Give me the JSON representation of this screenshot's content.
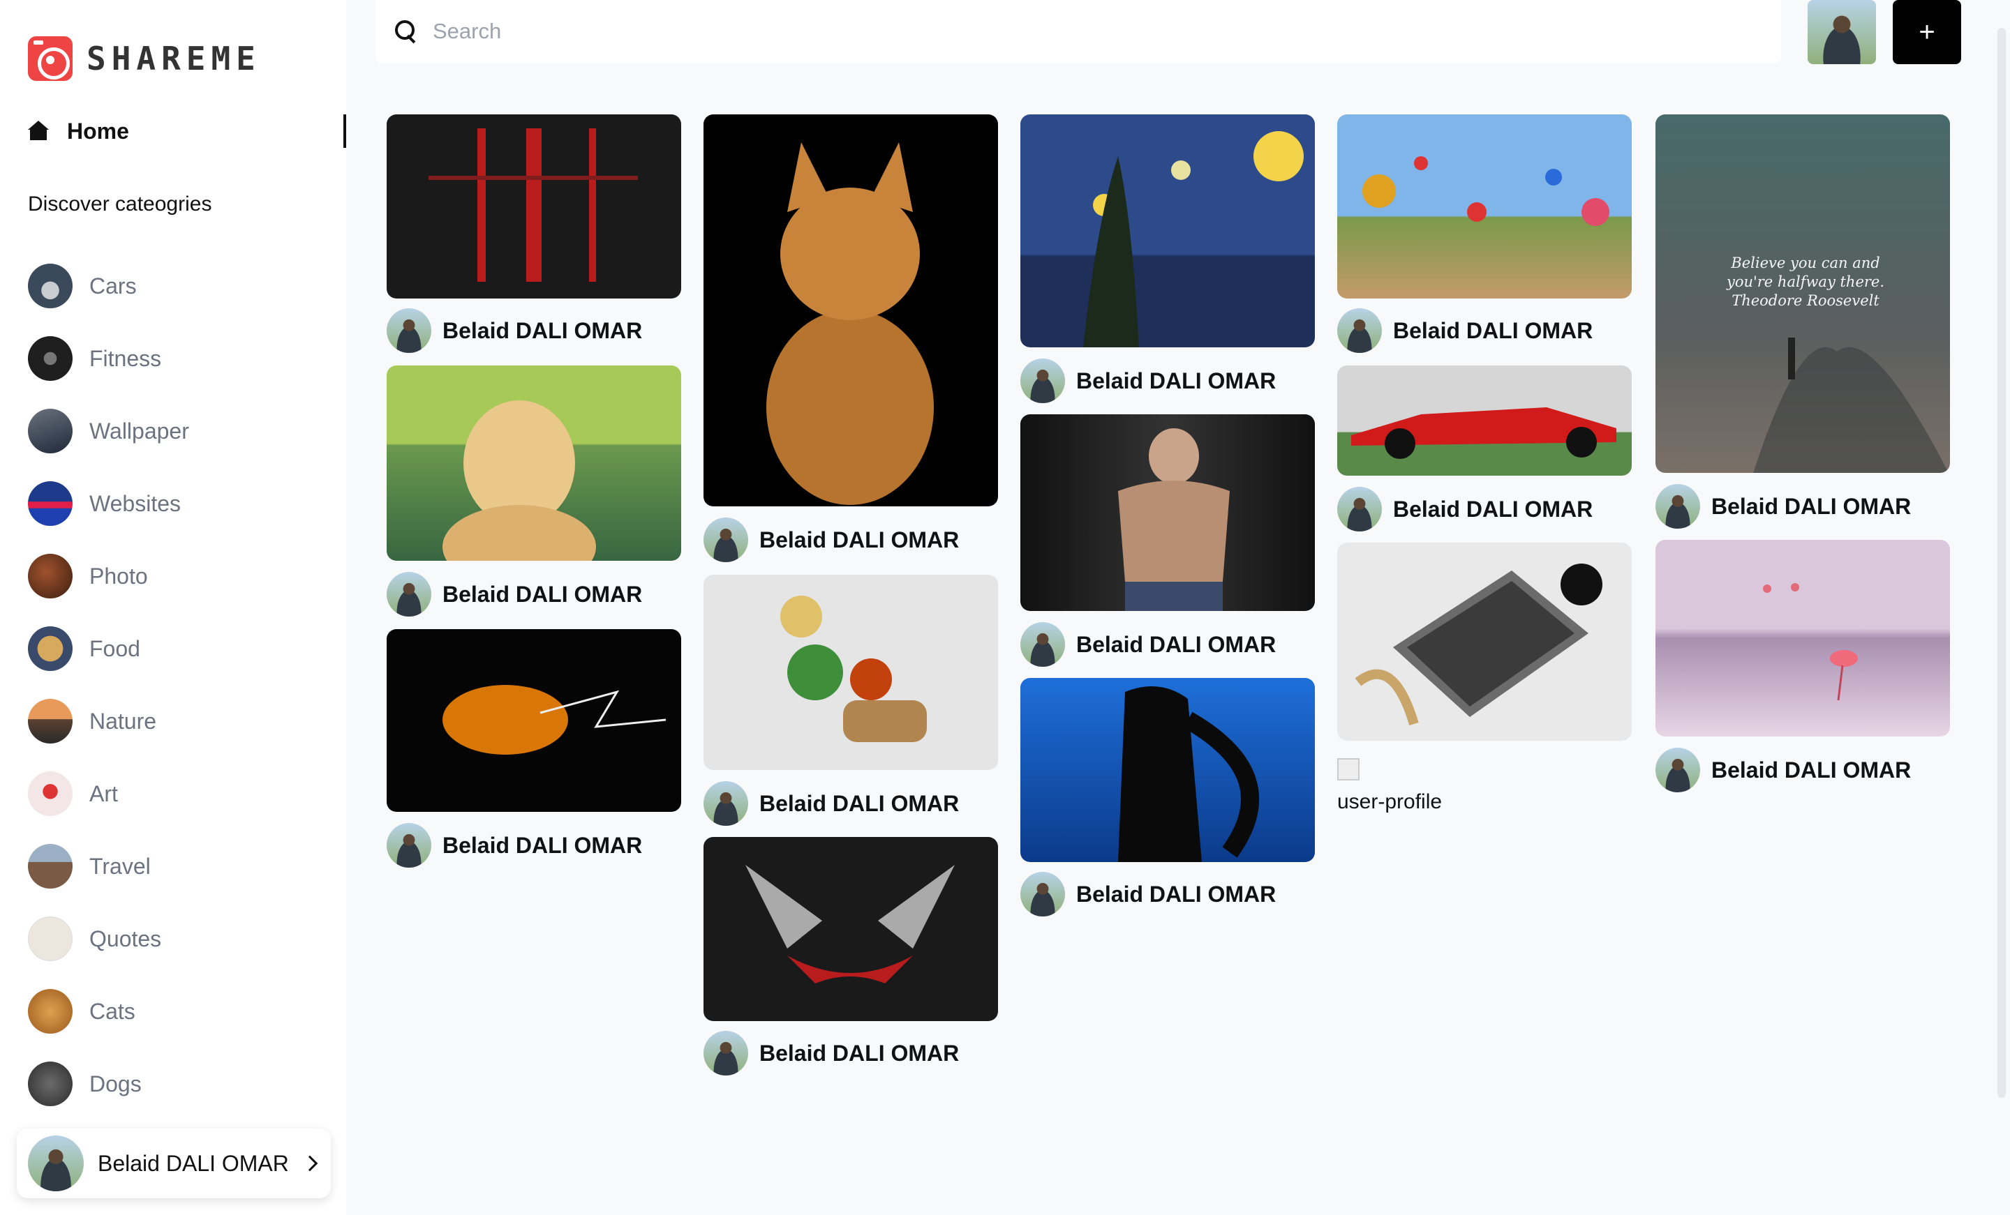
{
  "app": {
    "logo_text": "SHAREME",
    "brand_color": "#ef4444"
  },
  "sidebar": {
    "home_label": "Home",
    "discover_label": "Discover cateogries",
    "categories": [
      {
        "label": "Cars",
        "icon": "cars-thumb",
        "color": "#3b4a5a"
      },
      {
        "label": "Fitness",
        "icon": "fitness-thumb",
        "color": "#2a2a2a"
      },
      {
        "label": "Wallpaper",
        "icon": "wallpaper-thumb",
        "color": "#374151"
      },
      {
        "label": "Websites",
        "icon": "websites-thumb",
        "color": "#1e3a8a"
      },
      {
        "label": "Photo",
        "icon": "photo-thumb",
        "color": "#5c3a24"
      },
      {
        "label": "Food",
        "icon": "food-thumb",
        "color": "#8a6a3a"
      },
      {
        "label": "Nature",
        "icon": "nature-thumb",
        "color": "#b8632e"
      },
      {
        "label": "Art",
        "icon": "art-thumb",
        "color": "#d9a3a3"
      },
      {
        "label": "Travel",
        "icon": "travel-thumb",
        "color": "#6b4f3a"
      },
      {
        "label": "Quotes",
        "icon": "quotes-thumb",
        "color": "#e7e2d8"
      },
      {
        "label": "Cats",
        "icon": "cats-thumb",
        "color": "#c47a2c"
      },
      {
        "label": "Dogs",
        "icon": "dogs-thumb",
        "color": "#4b4b4b"
      }
    ],
    "profile_name": "Belaid DALI OMAR"
  },
  "topbar": {
    "search_placeholder": "Search",
    "add_label": "+"
  },
  "pins": [
    {
      "id": "p1",
      "author": "Belaid DALI OMAR",
      "subject": "swords-art"
    },
    {
      "id": "p2",
      "author": "Belaid DALI OMAR",
      "subject": "golden-retriever"
    },
    {
      "id": "p3",
      "author": "Belaid DALI OMAR",
      "subject": "orange-dark-art"
    },
    {
      "id": "p4",
      "author": "Belaid DALI OMAR",
      "subject": "tabby-cat"
    },
    {
      "id": "p5",
      "author": "Belaid DALI OMAR",
      "subject": "food-platter"
    },
    {
      "id": "p6",
      "author": "Belaid DALI OMAR",
      "subject": "dark-knight-art"
    },
    {
      "id": "p7",
      "author": "Belaid DALI OMAR",
      "subject": "starry-night"
    },
    {
      "id": "p8",
      "author": "Belaid DALI OMAR",
      "subject": "bodybuilder"
    },
    {
      "id": "p9",
      "author": "Belaid DALI OMAR",
      "subject": "anime-warrior"
    },
    {
      "id": "p10",
      "author": "Belaid DALI OMAR",
      "subject": "hot-air-balloons"
    },
    {
      "id": "p11",
      "author": "Belaid DALI OMAR",
      "subject": "f1-car"
    },
    {
      "id": "p12",
      "author": "",
      "subject": "laptop-desk",
      "broken_alt": "user-profile"
    },
    {
      "id": "p13",
      "author": "Belaid DALI OMAR",
      "subject": "quote-image",
      "quote_text": "Believe you can and you're halfway there. Theodore Roosevelt"
    },
    {
      "id": "p14",
      "author": "Belaid DALI OMAR",
      "subject": "flamingo-lake"
    }
  ]
}
